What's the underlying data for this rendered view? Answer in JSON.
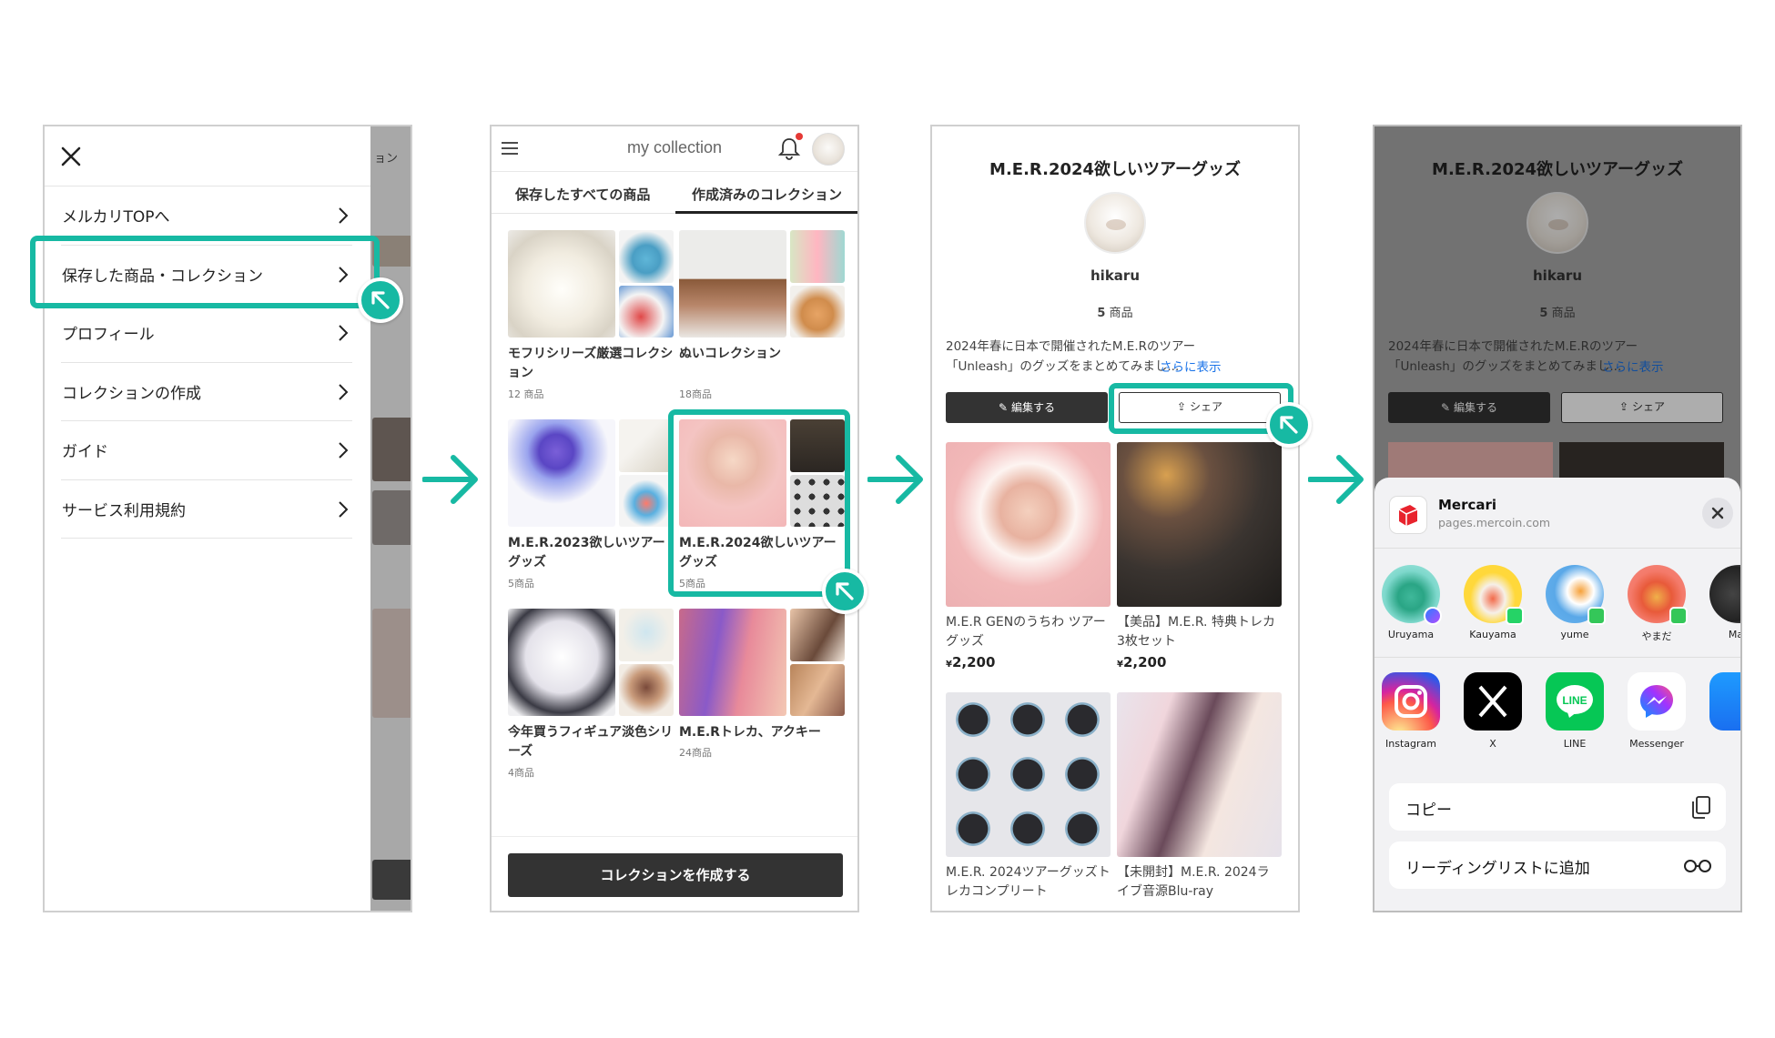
{
  "panel1": {
    "menu_items": [
      {
        "label": "メルカリTOPへ"
      },
      {
        "label": "保存した商品・コレクション"
      },
      {
        "label": "プロフィール"
      },
      {
        "label": "コレクションの作成"
      },
      {
        "label": "ガイド"
      },
      {
        "label": "サービス利用規約"
      }
    ],
    "background_tab_fragment": "ョン"
  },
  "panel2": {
    "title": "my collection",
    "tabs": [
      "保存したすべての商品",
      "作成済みのコレクション"
    ],
    "collections": [
      {
        "title": "モフリシリーズ厳選コレクション",
        "count": "12 商品"
      },
      {
        "title": "ぬいコレクション",
        "count": "18商品"
      },
      {
        "title": "M.E.R.2023欲しいツアーグッズ",
        "count": "5商品"
      },
      {
        "title": "M.E.R.2024欲しいツアーグッズ",
        "count": "5商品"
      },
      {
        "title": "今年買うフィギュア淡色シリーズ",
        "count": "4商品"
      },
      {
        "title": "M.E.Rトレカ、アクキー",
        "count": "24商品"
      }
    ],
    "create_button": "コレクションを作成する"
  },
  "detail": {
    "title": "M.E.R.2024欲しいツアーグッズ",
    "owner": "hikaru",
    "count_number": "5",
    "count_unit": " 商品",
    "description_line1": "2024年春に日本で開催されたM.E.Rのツアー",
    "description_line2": "「Unleash」のグッズをまとめてみまし...",
    "more_link": "さらに表示",
    "edit_button": "編集する",
    "share_button": "シェア",
    "products": [
      {
        "title": "M.E.R GENのうちわ ツアーグッズ",
        "currency": "¥",
        "price": "2,200"
      },
      {
        "title": "【美品】M.E.R. 特典トレカ3枚セット",
        "currency": "¥",
        "price": "2,200"
      },
      {
        "title": "M.E.R. 2024ツアーグッズトレカコンプリート",
        "currency": "",
        "price": ""
      },
      {
        "title": "【未開封】M.E.R. 2024ライブ音源Blu-ray",
        "currency": "",
        "price": ""
      }
    ]
  },
  "share_sheet": {
    "app_name": "Mercari",
    "url": "pages.mercoin.com",
    "people": [
      {
        "name": "Uruyama"
      },
      {
        "name": "Kauyama"
      },
      {
        "name": "yume"
      },
      {
        "name": "やまだ"
      },
      {
        "name": "Mac"
      }
    ],
    "apps": [
      {
        "name": "Instagram"
      },
      {
        "name": "X"
      },
      {
        "name": "LINE"
      },
      {
        "name": "Messenger"
      }
    ],
    "actions": [
      {
        "label": "コピー"
      },
      {
        "label": "リーディングリストに追加"
      }
    ]
  },
  "colors": {
    "accent_teal": "#17b9a3",
    "dark_button": "#333333",
    "link_blue": "#1a73e8"
  }
}
